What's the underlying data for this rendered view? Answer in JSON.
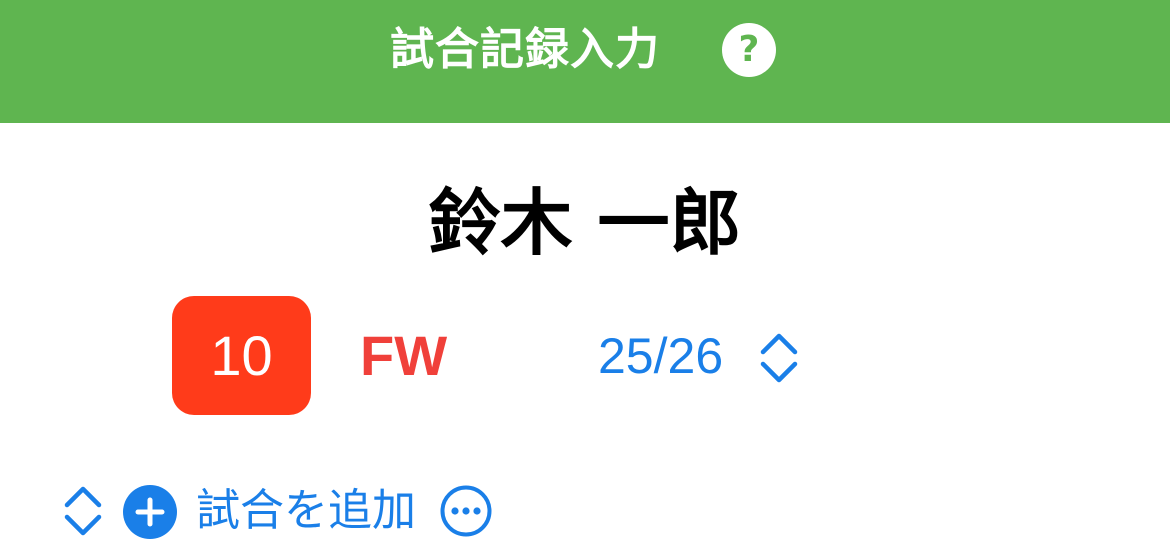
{
  "header": {
    "title": "試合記録入力",
    "help_symbol": "?",
    "background_color": "#5fb550"
  },
  "player": {
    "name": "鈴木 一郎",
    "number": "10",
    "position": "FW",
    "season": "25/26"
  },
  "actions": {
    "add_match_label": "試合を追加"
  },
  "colors": {
    "accent_blue": "#1a7fe8",
    "badge_red": "#ff3b1a",
    "position_red": "#f0403a"
  },
  "icons": {
    "help": "question-circle-icon",
    "season_stepper": "chevron-up-down-icon",
    "reorder": "chevron-up-down-icon",
    "add": "plus-circle-fill-icon",
    "more": "ellipsis-circle-icon"
  }
}
